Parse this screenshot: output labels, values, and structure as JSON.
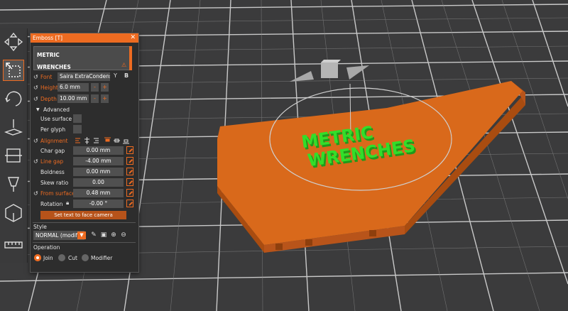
{
  "panel": {
    "title": "Emboss [T]",
    "close_glyph": "✕",
    "text_value_line1": "METRIC",
    "text_value_line2": "WRENCHES",
    "warning_icon": "warning-triangle-icon",
    "font_label": "Font",
    "font_value": "Saira ExtraCondensed",
    "height_label": "Height",
    "height_value": "6.0 mm",
    "depth_label": "Depth",
    "depth_value": "10.00 mm",
    "advanced_label": "Advanced",
    "use_surface_label": "Use surface",
    "per_glyph_label": "Per glyph",
    "alignment_label": "Alignment",
    "char_gap_label": "Char gap",
    "char_gap_value": "0.00 mm",
    "line_gap_label": "Line gap",
    "line_gap_value": "-4.00 mm",
    "boldness_label": "Boldness",
    "boldness_value": "0.00 mm",
    "skew_label": "Skew ratio",
    "skew_value": "0.00",
    "from_surface_label": "From surface",
    "from_surface_value": "0.48 mm",
    "rotation_label": "Rotation",
    "rotation_value": "-0.00 °",
    "face_camera_button": "Set text to face camera",
    "style_label": "Style",
    "style_value": "NORMAL (modifie",
    "operation_label": "Operation",
    "op_join": "Join",
    "op_cut": "Cut",
    "op_modifier": "Modifier",
    "minus": "-",
    "plus": "+"
  },
  "scene": {
    "embossed_line1": "METRIC",
    "embossed_line2": "WRENCHES",
    "part_color": "#d9691b",
    "text_color": "#2fd42a",
    "bed_color": "#3b3b3c",
    "grid_color": "#e8e8e8"
  },
  "colors": {
    "accent": "#ed6b21",
    "panel_bg": "#2d2d2d"
  }
}
